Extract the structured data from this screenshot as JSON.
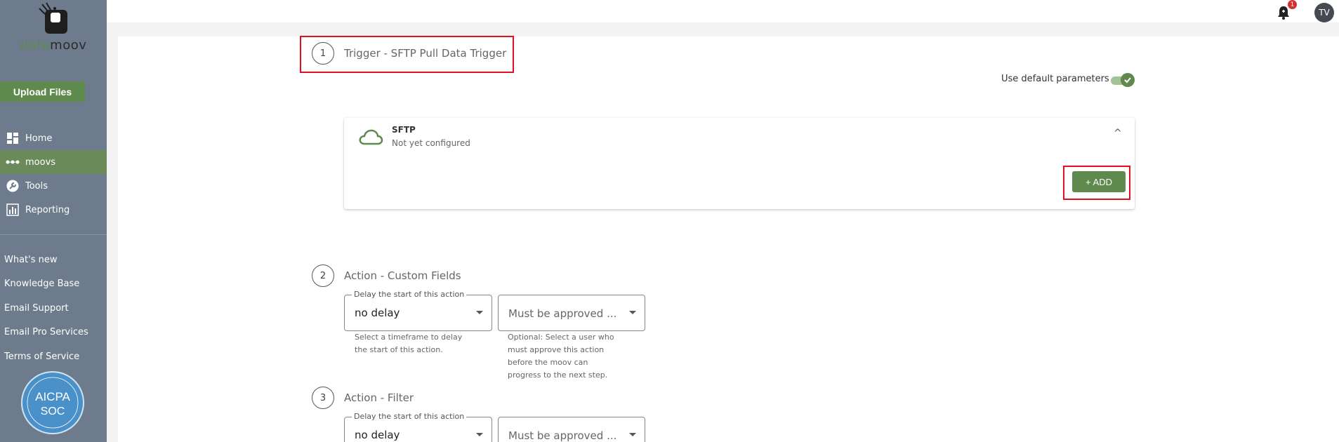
{
  "sidebar": {
    "logo": {
      "part1": "data",
      "part2": "moov"
    },
    "upload_label": "Upload Files",
    "nav": [
      {
        "label": "Home",
        "icon": "dashboard-icon"
      },
      {
        "label": "moovs",
        "icon": "dots-icon"
      },
      {
        "label": "Tools",
        "icon": "wrench-icon"
      },
      {
        "label": "Reporting",
        "icon": "chart-icon"
      }
    ],
    "links": [
      "What's new",
      "Knowledge Base",
      "Email Support",
      "Email Pro Services",
      "Terms of Service"
    ],
    "badge": {
      "line1": "AICPA",
      "line2": "SOC"
    }
  },
  "topbar": {
    "notification_count": "1",
    "avatar_initials": "TV"
  },
  "trigger": {
    "number": "1",
    "title": "Trigger - SFTP Pull Data Trigger",
    "default_params_label": "Use default parameters",
    "card": {
      "title": "SFTP",
      "status": "Not yet configured",
      "add_label": "+ ADD"
    }
  },
  "actions": [
    {
      "number": "2",
      "title": "Action - Custom Fields",
      "delay_legend": "Delay the start of this action",
      "delay_value": "no delay",
      "delay_help": [
        "Select a timeframe to delay",
        "the start of this action."
      ],
      "approval_placeholder": "Must be approved ...",
      "approval_help": [
        "Optional: Select a user who",
        "must approve this action",
        "before the moov can",
        "progress to the next step."
      ]
    },
    {
      "number": "3",
      "title": "Action - Filter",
      "delay_legend": "Delay the start of this action",
      "delay_value": "no delay",
      "approval_placeholder": "Must be approved ..."
    }
  ],
  "colors": {
    "sidebar": "#6d7b8c",
    "accent": "#5f8a4d",
    "highlight": "#e0101f"
  }
}
